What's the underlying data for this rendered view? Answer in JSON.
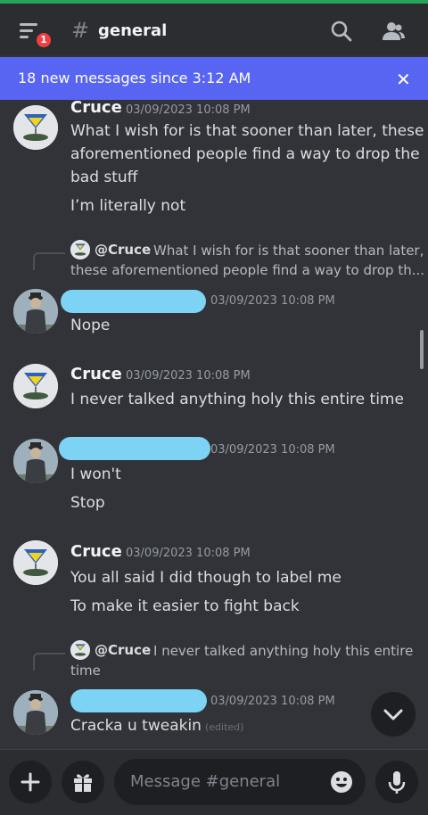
{
  "header": {
    "notification_count": "1",
    "hash": "#",
    "channel_name": "general"
  },
  "banner": {
    "text": "18 new messages since 3:12 AM",
    "close": "✕"
  },
  "messages": [
    {
      "author": "Cruce",
      "timestamp": "03/09/2023 10:08 PM",
      "lines": [
        "What I wish for is that sooner than later, these",
        "aforementioned people find a way to drop the",
        "bad stuff",
        "I’m literally not"
      ]
    },
    {
      "reply_to": "@Cruce",
      "reply_preview_1": "What I wish for is that sooner than later,",
      "reply_preview_2": "these aforementioned people find a way to drop th...",
      "timestamp": "03/09/2023 10:08 PM",
      "lines": [
        "Nope"
      ]
    },
    {
      "author": "Cruce",
      "timestamp": "03/09/2023 10:08 PM",
      "lines": [
        "I never talked anything holy this entire time"
      ]
    },
    {
      "timestamp": "03/09/2023 10:08 PM",
      "lines": [
        "I won't",
        "Stop"
      ]
    },
    {
      "author": "Cruce",
      "timestamp": "03/09/2023 10:08 PM",
      "lines": [
        "You all said I did though to label me",
        "To make it easier to fight back"
      ]
    },
    {
      "reply_to": "@Cruce",
      "reply_preview_1": "I never talked anything holy this entire",
      "reply_preview_2": "time",
      "timestamp": "03/09/2023 10:08 PM",
      "lines": [
        "Cracka u tweakin"
      ],
      "edited_label": "(edited)"
    }
  ],
  "composer": {
    "placeholder": "Message #general"
  },
  "colors": {
    "accent": "#5865f2",
    "online": "#23a55a",
    "badge": "#f23f43",
    "background": "#313338"
  },
  "icons": [
    "menu-icon",
    "search-icon",
    "members-icon",
    "close-icon",
    "plus-icon",
    "gift-icon",
    "emoji-icon",
    "mic-icon",
    "chevron-down-icon"
  ]
}
